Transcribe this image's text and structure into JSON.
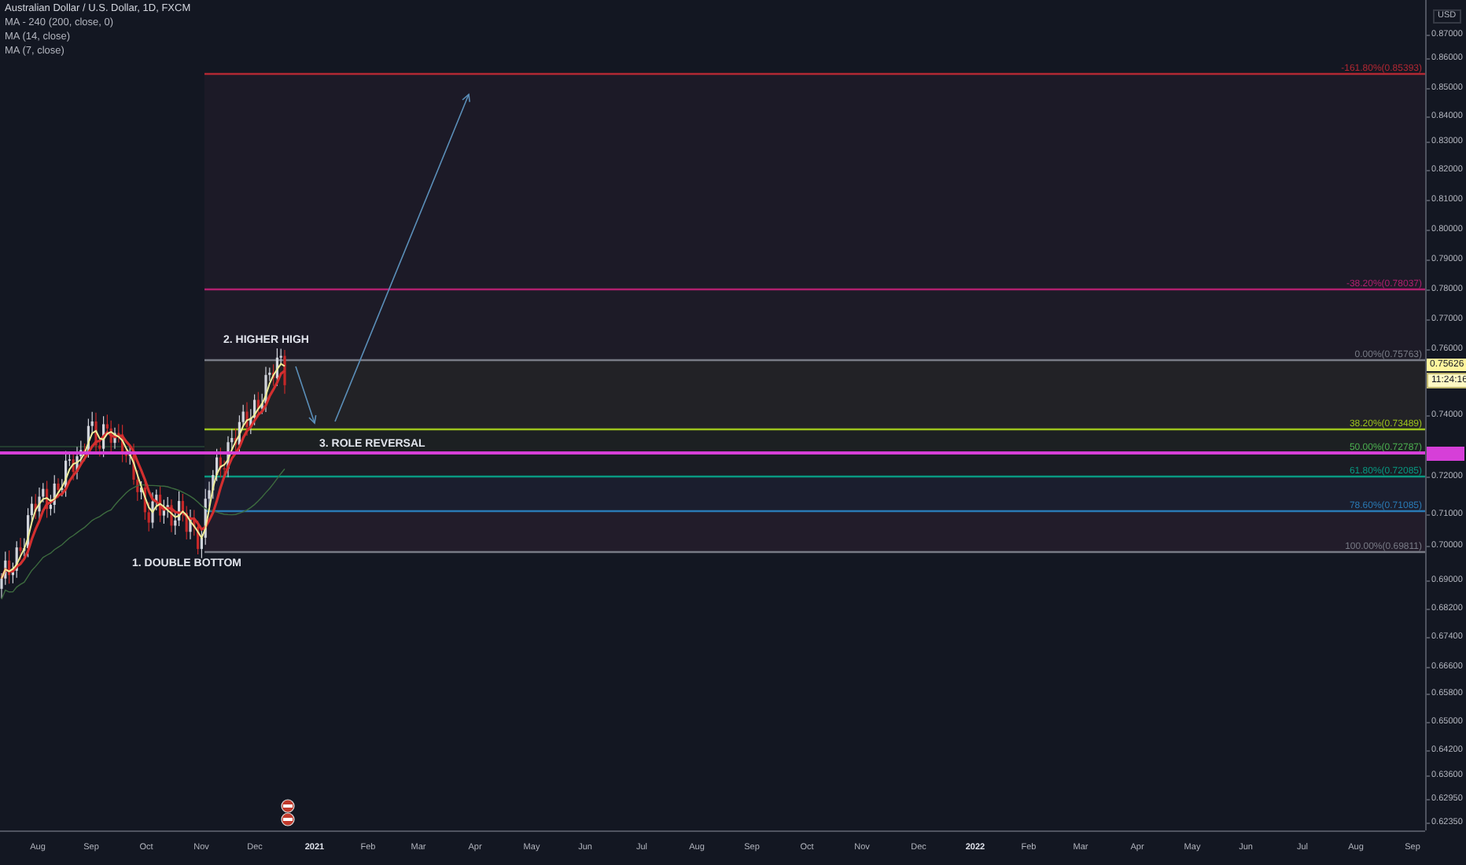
{
  "legend": {
    "symbol": "Australian Dollar / U.S. Dollar, 1D, FXCM",
    "indicators": [
      "MA - 240 (200, close, 0)",
      "MA (14, close)",
      "MA (7, close)"
    ]
  },
  "annotations": [
    {
      "text": "2. HIGHER HIGH"
    },
    {
      "text": "3. ROLE REVERSAL"
    },
    {
      "text": "1. DOUBLE BOTTOM"
    }
  ],
  "fib_levels": [
    {
      "label": "-161.80%(0.85393)",
      "color": "#b22833"
    },
    {
      "label": "-38.20%(0.78037)",
      "color": "#b0206f"
    },
    {
      "label": "0.00%(0.75763)",
      "color": "#787b86"
    },
    {
      "label": "38.20%(0.73489)",
      "color": "#9cc31d"
    },
    {
      "label": "50.00%(0.72787)",
      "color": "#4caf50"
    },
    {
      "label": "61.80%(0.72085)",
      "color": "#089981"
    },
    {
      "label": "78.60%(0.71085)",
      "color": "#2a7ab5"
    },
    {
      "label": "100.00%(0.69811)",
      "color": "#787b86"
    }
  ],
  "price_axis": {
    "currency": "USD",
    "last_price": "0.75626",
    "countdown": "11:24:16",
    "ticks": [
      "0.87000",
      "0.86000",
      "0.85000",
      "0.84000",
      "0.83000",
      "0.82000",
      "0.81000",
      "0.80000",
      "0.79000",
      "0.78000",
      "0.77000",
      "0.76000",
      "0.74000",
      "0.72000",
      "0.71000",
      "0.70000",
      "0.69000",
      "0.68200",
      "0.67400",
      "0.66600",
      "0.65800",
      "0.65000",
      "0.64200",
      "0.63600",
      "0.62950",
      "0.62350"
    ]
  },
  "time_axis": {
    "labels": [
      {
        "text": "Aug",
        "kind": "month"
      },
      {
        "text": "Sep",
        "kind": "month"
      },
      {
        "text": "Oct",
        "kind": "month"
      },
      {
        "text": "Nov",
        "kind": "month"
      },
      {
        "text": "Dec",
        "kind": "month"
      },
      {
        "text": "2021",
        "kind": "year"
      },
      {
        "text": "Feb",
        "kind": "month"
      },
      {
        "text": "Mar",
        "kind": "month"
      },
      {
        "text": "Apr",
        "kind": "month"
      },
      {
        "text": "May",
        "kind": "month"
      },
      {
        "text": "Jun",
        "kind": "month"
      },
      {
        "text": "Jul",
        "kind": "month"
      },
      {
        "text": "Aug",
        "kind": "month"
      },
      {
        "text": "Sep",
        "kind": "month"
      },
      {
        "text": "Oct",
        "kind": "month"
      },
      {
        "text": "Nov",
        "kind": "month"
      },
      {
        "text": "Dec",
        "kind": "month"
      },
      {
        "text": "2022",
        "kind": "year"
      },
      {
        "text": "Feb",
        "kind": "month"
      },
      {
        "text": "Mar",
        "kind": "month"
      },
      {
        "text": "Apr",
        "kind": "month"
      },
      {
        "text": "May",
        "kind": "month"
      },
      {
        "text": "Jun",
        "kind": "month"
      },
      {
        "text": "Jul",
        "kind": "month"
      },
      {
        "text": "Aug",
        "kind": "month"
      },
      {
        "text": "Sep",
        "kind": "month"
      }
    ]
  }
}
